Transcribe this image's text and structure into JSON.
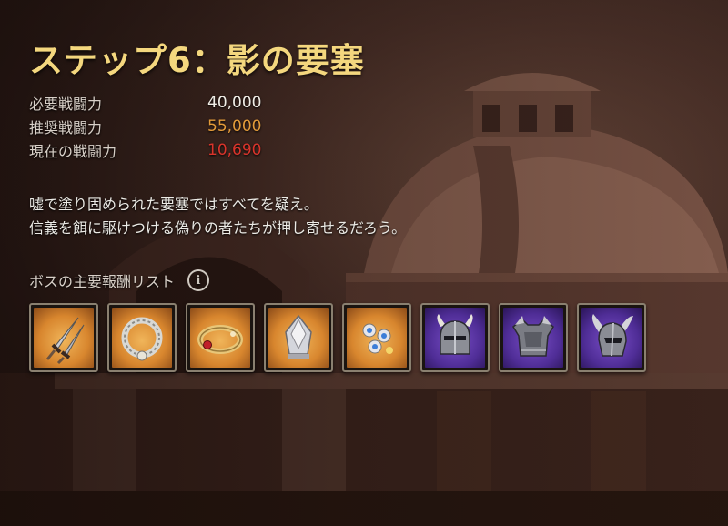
{
  "title": "ステップ6：影の要塞",
  "stats": [
    {
      "label": "必要戦闘力",
      "value": "40,000",
      "color": "#f0ede6"
    },
    {
      "label": "推奨戦闘力",
      "value": "55,000",
      "color": "#e29a3a"
    },
    {
      "label": "現在の戦闘力",
      "value": "10,690",
      "color": "#d9342b"
    }
  ],
  "description": [
    "嘘で塗り固められた要塞ではすべてを疑え。",
    "信義を餌に駆けつける偽りの者たちが押し寄せるだろう。"
  ],
  "rewards": {
    "header": "ボスの主要報酬リスト",
    "info_icon": "i",
    "items": [
      {
        "icon": "twin-daggers-icon",
        "rarity": "orange"
      },
      {
        "icon": "silver-necklace-icon",
        "rarity": "orange"
      },
      {
        "icon": "gold-ruby-bracelet-icon",
        "rarity": "orange"
      },
      {
        "icon": "silver-gem-ornament-icon",
        "rarity": "orange"
      },
      {
        "icon": "jeweled-earrings-icon",
        "rarity": "orange"
      },
      {
        "icon": "horned-helmet-icon",
        "rarity": "purple"
      },
      {
        "icon": "plate-armor-icon",
        "rarity": "purple"
      },
      {
        "icon": "winged-helmet-icon",
        "rarity": "purple"
      }
    ]
  }
}
